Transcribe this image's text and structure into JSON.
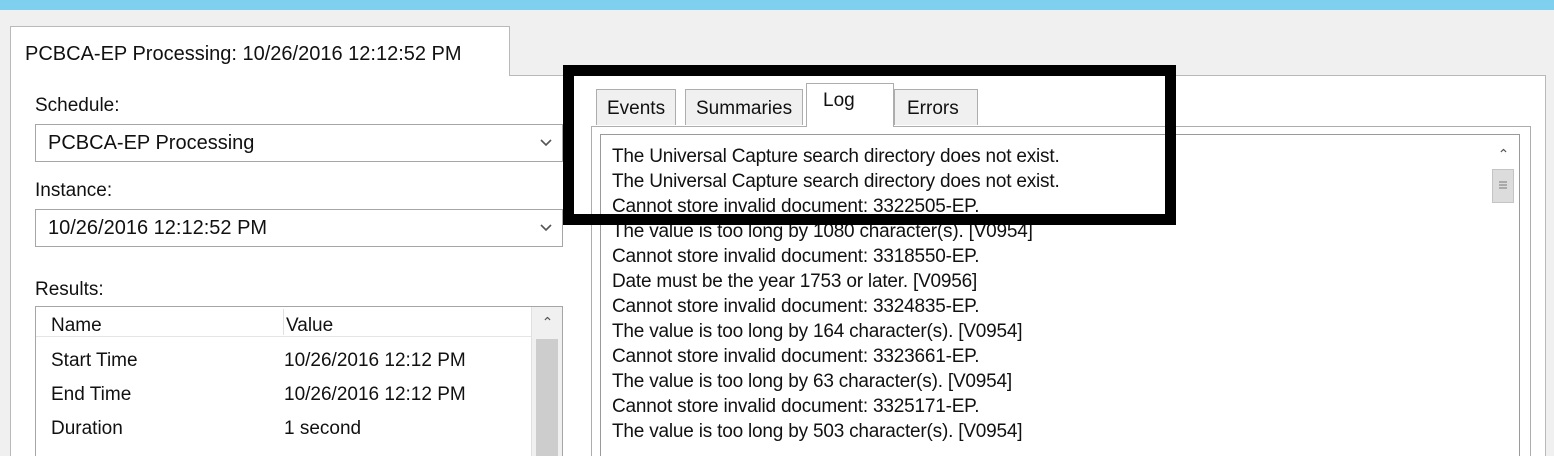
{
  "window": {
    "main_tab_title": "PCBCA-EP Processing: 10/26/2016 12:12:52 PM"
  },
  "schedule": {
    "label": "Schedule:",
    "value": "PCBCA-EP Processing"
  },
  "instance": {
    "label": "Instance:",
    "value": "10/26/2016 12:12:52 PM"
  },
  "results": {
    "label": "Results:",
    "columns": [
      "Name",
      "Value"
    ],
    "rows": [
      {
        "name": "Start Time",
        "value": "10/26/2016 12:12 PM"
      },
      {
        "name": "End Time",
        "value": "10/26/2016 12:12 PM"
      },
      {
        "name": "Duration",
        "value": "1 second"
      }
    ]
  },
  "tabs": [
    {
      "label": "Events",
      "active": false
    },
    {
      "label": "Summaries",
      "active": false
    },
    {
      "label": "Log",
      "active": true
    },
    {
      "label": "Errors",
      "active": false
    }
  ],
  "log_lines": [
    "The Universal Capture search directory does not exist.",
    "The Universal Capture search directory does not exist.",
    "Cannot store invalid document: 3322505-EP.",
    "The value is too long by 1080 character(s). [V0954]",
    "Cannot store invalid document: 3318550-EP.",
    "Date must be the year 1753 or later.  [V0956]",
    "Cannot store invalid document: 3324835-EP.",
    "The value is too long by 164 character(s). [V0954]",
    "Cannot store invalid document: 3323661-EP.",
    "The value is too long by 63 character(s). [V0954]",
    "Cannot store invalid document: 3325171-EP.",
    "The value is too long by 503 character(s). [V0954]"
  ],
  "log_scroll_position": 0,
  "colors": {
    "title_bar": "#7fd0ee",
    "highlight_frame": "#000000"
  }
}
